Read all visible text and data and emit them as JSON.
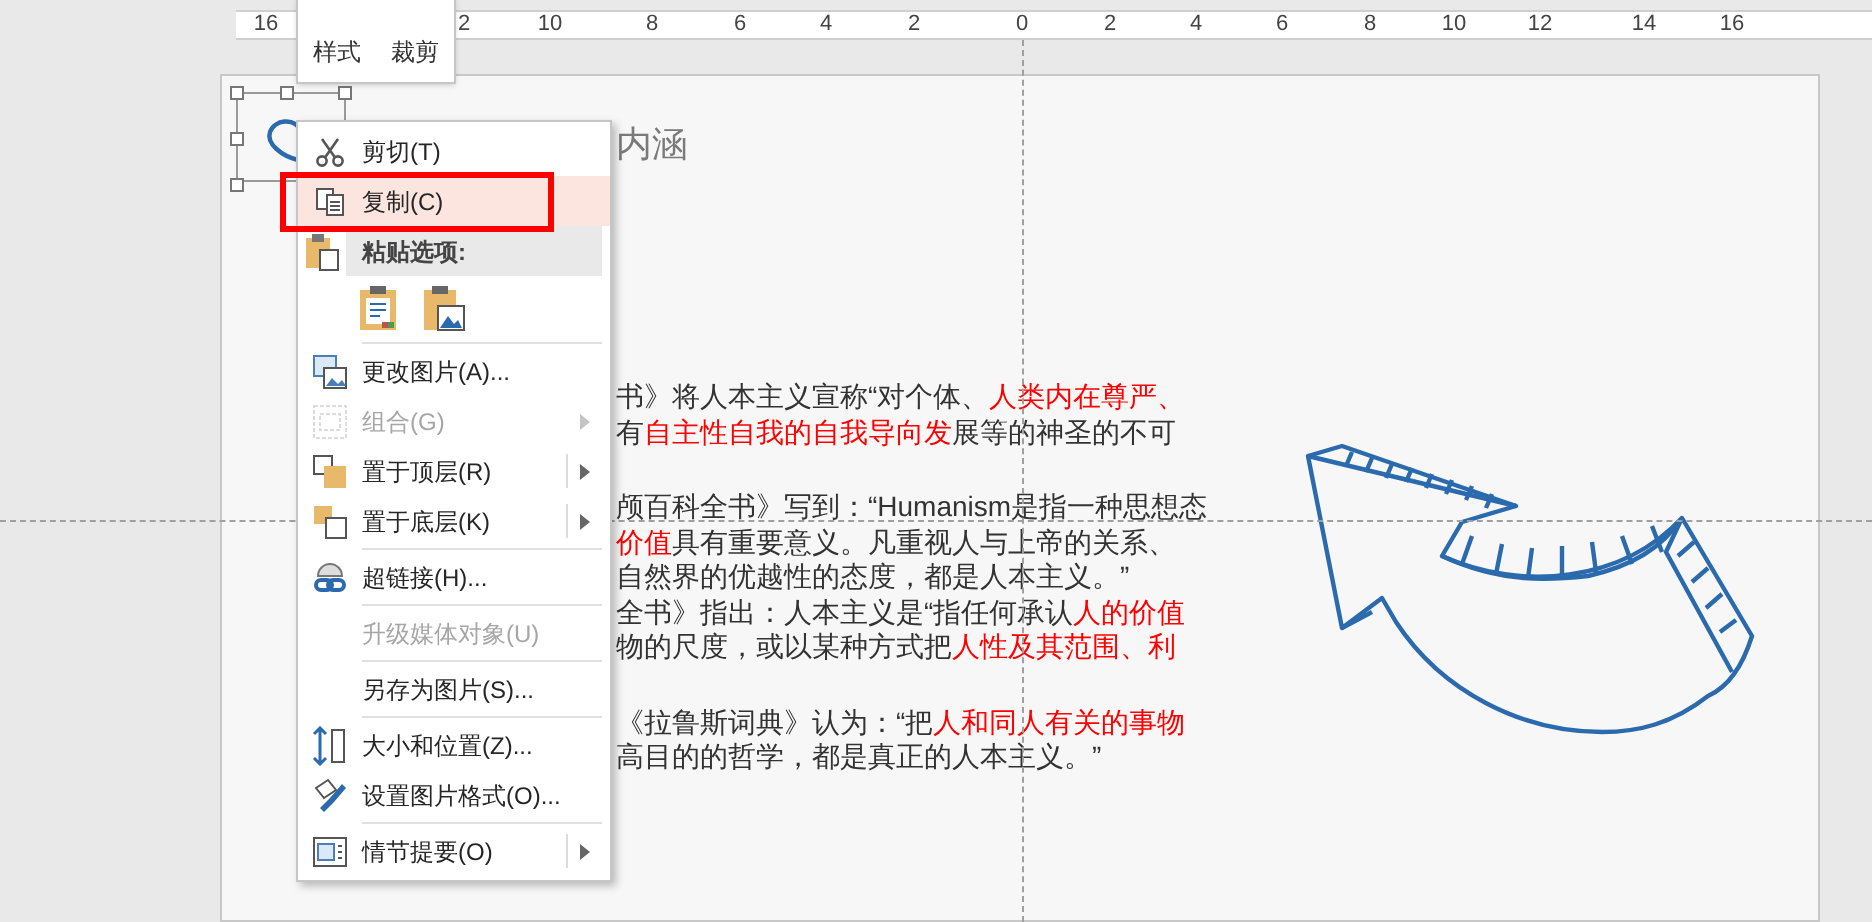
{
  "ruler": {
    "labels": [
      "16",
      "2",
      "10",
      "8",
      "6",
      "4",
      "2",
      "0",
      "2",
      "4",
      "6",
      "8",
      "10",
      "12",
      "14",
      "16"
    ]
  },
  "mini_toolbar": {
    "buttons": [
      {
        "label": "样式"
      },
      {
        "label": "裁剪"
      }
    ]
  },
  "slide": {
    "title": "内涵",
    "paragraphs": [
      {
        "lines": [
          [
            {
              "text": "书》将人本主义宣称“对个体、",
              "emphasis": false
            },
            {
              "text": "人类内在尊严、",
              "emphasis": true
            }
          ],
          [
            {
              "text": "有",
              "emphasis": false
            },
            {
              "text": "自主性自我的自我导向发",
              "emphasis": true
            },
            {
              "text": "展等的神圣的不可",
              "emphasis": false
            }
          ]
        ]
      },
      {
        "lines": [
          [
            {
              "text": "颅百科全书》写到：“Humanism是指一种思想态",
              "emphasis": false
            }
          ],
          [
            {
              "text": "价值",
              "emphasis": true
            },
            {
              "text": "具有重要意义。凡重视人与上帝的关系、",
              "emphasis": false
            }
          ],
          [
            {
              "text": "自然界的优越性的态度，都是人本主义。”",
              "emphasis": false
            }
          ],
          [
            {
              "text": "全书》指出：人本主义是“指任何承认",
              "emphasis": false
            },
            {
              "text": "人的价值",
              "emphasis": true
            }
          ],
          [
            {
              "text": "物的尺度，或以某种方式把",
              "emphasis": false
            },
            {
              "text": "人性及其范围、利",
              "emphasis": true
            }
          ]
        ]
      },
      {
        "lines": [
          [
            {
              "text": "《拉鲁斯词典》认为：“把",
              "emphasis": false
            },
            {
              "text": "人和同人有关的事物",
              "emphasis": true
            }
          ],
          [
            {
              "text": "高目的的哲学，都是真正的人本主义。”",
              "emphasis": false
            }
          ]
        ]
      }
    ]
  },
  "context_menu": {
    "groups": [
      {
        "items": [
          {
            "kind": "command",
            "label": "剪切(T)",
            "selected": false,
            "disabled": false,
            "submenu": false,
            "annotated": false
          },
          {
            "kind": "command",
            "label": "复制(C)",
            "selected": true,
            "disabled": false,
            "submenu": false,
            "annotated": true
          },
          {
            "kind": "section",
            "label": "粘贴选项:"
          },
          {
            "kind": "paste_options"
          }
        ]
      },
      {
        "items": [
          {
            "kind": "command",
            "label": "更改图片(A)...",
            "selected": false,
            "disabled": false,
            "submenu": false,
            "annotated": false
          },
          {
            "kind": "command",
            "label": "组合(G)",
            "selected": false,
            "disabled": true,
            "submenu": true,
            "annotated": false
          },
          {
            "kind": "command",
            "label": "置于顶层(R)",
            "selected": false,
            "disabled": false,
            "submenu": true,
            "annotated": false
          },
          {
            "kind": "command",
            "label": "置于底层(K)",
            "selected": false,
            "disabled": false,
            "submenu": true,
            "annotated": false
          }
        ]
      },
      {
        "items": [
          {
            "kind": "command",
            "label": "超链接(H)...",
            "selected": false,
            "disabled": false,
            "submenu": false,
            "annotated": false
          }
        ]
      },
      {
        "items": [
          {
            "kind": "command",
            "label": "升级媒体对象(U)",
            "selected": false,
            "disabled": true,
            "submenu": false,
            "annotated": false
          }
        ]
      },
      {
        "items": [
          {
            "kind": "command",
            "label": "另存为图片(S)...",
            "selected": false,
            "disabled": false,
            "submenu": false,
            "annotated": false
          }
        ]
      },
      {
        "items": [
          {
            "kind": "command",
            "label": "大小和位置(Z)...",
            "selected": false,
            "disabled": false,
            "submenu": false,
            "annotated": false
          },
          {
            "kind": "command",
            "label": "设置图片格式(O)...",
            "selected": false,
            "disabled": false,
            "submenu": false,
            "annotated": false
          }
        ]
      },
      {
        "items": [
          {
            "kind": "command",
            "label": "情节提要(O)",
            "selected": false,
            "disabled": false,
            "submenu": true,
            "annotated": false
          }
        ]
      }
    ]
  }
}
